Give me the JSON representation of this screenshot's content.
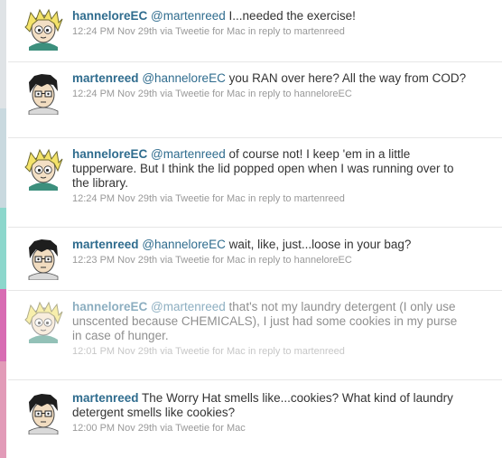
{
  "colors": {
    "link": "#2f6c8e",
    "text": "#333333",
    "meta": "#999999",
    "left_edge": [
      "#dfe3e6",
      "#c9d9df",
      "#8cd7cc",
      "#d86cb3",
      "#e29bb8"
    ]
  },
  "tweets": [
    {
      "avatar": "hanneloreEC-avatar",
      "user": "hanneloreEC",
      "parts": [
        {
          "t": "mention",
          "v": "@martenreed"
        },
        {
          "t": "text",
          "v": " I...needed the exercise!"
        }
      ],
      "meta": {
        "time": "12:24 PM Nov 29th",
        "via_prefix": " via ",
        "client": "Tweetie for Mac",
        "reply_prefix": " in reply to ",
        "reply_to": "martenreed"
      }
    },
    {
      "avatar": "martenreed-avatar",
      "user": "martenreed",
      "parts": [
        {
          "t": "mention",
          "v": "@hanneloreEC"
        },
        {
          "t": "text",
          "v": " you RAN over here? All the way from COD?"
        }
      ],
      "meta": {
        "time": "12:24 PM Nov 29th",
        "via_prefix": " via ",
        "client": "Tweetie for Mac",
        "reply_prefix": " in reply to ",
        "reply_to": "hanneloreEC"
      }
    },
    {
      "avatar": "hanneloreEC-avatar",
      "user": "hanneloreEC",
      "parts": [
        {
          "t": "mention",
          "v": "@martenreed"
        },
        {
          "t": "text",
          "v": " of course not! I keep 'em in a little tupperware. But I think the lid popped open when I was running over to the library."
        }
      ],
      "meta": {
        "time": "12:24 PM Nov 29th",
        "via_prefix": " via ",
        "client": "Tweetie for Mac",
        "reply_prefix": " in reply to ",
        "reply_to": "martenreed"
      }
    },
    {
      "avatar": "martenreed-avatar",
      "user": "martenreed",
      "parts": [
        {
          "t": "mention",
          "v": "@hanneloreEC"
        },
        {
          "t": "text",
          "v": " wait, like, just...loose in your bag?"
        }
      ],
      "meta": {
        "time": "12:23 PM Nov 29th",
        "via_prefix": " via ",
        "client": "Tweetie for Mac",
        "reply_prefix": " in reply to ",
        "reply_to": "hanneloreEC"
      }
    },
    {
      "avatar": "hanneloreEC-avatar",
      "user": "hanneloreEC",
      "faded": true,
      "parts": [
        {
          "t": "mention",
          "v": "@martenreed"
        },
        {
          "t": "text",
          "v": " that's not my laundry detergent (I only use unscented because CHEMICALS), I just had some cookies in my purse in case of hunger."
        }
      ],
      "meta": {
        "time": "12:01 PM Nov 29th",
        "via_prefix": " via ",
        "client": "Tweetie for Mac",
        "reply_prefix": " in reply to ",
        "reply_to": "martenreed"
      }
    },
    {
      "avatar": "martenreed-avatar",
      "user": "martenreed",
      "parts": [
        {
          "t": "text",
          "v": " The Worry Hat smells like...cookies? What kind of laundry detergent smells like cookies?"
        }
      ],
      "meta": {
        "time": "12:00 PM Nov 29th",
        "via_prefix": " via ",
        "client": "Tweetie for Mac",
        "reply_prefix": "",
        "reply_to": ""
      }
    }
  ]
}
